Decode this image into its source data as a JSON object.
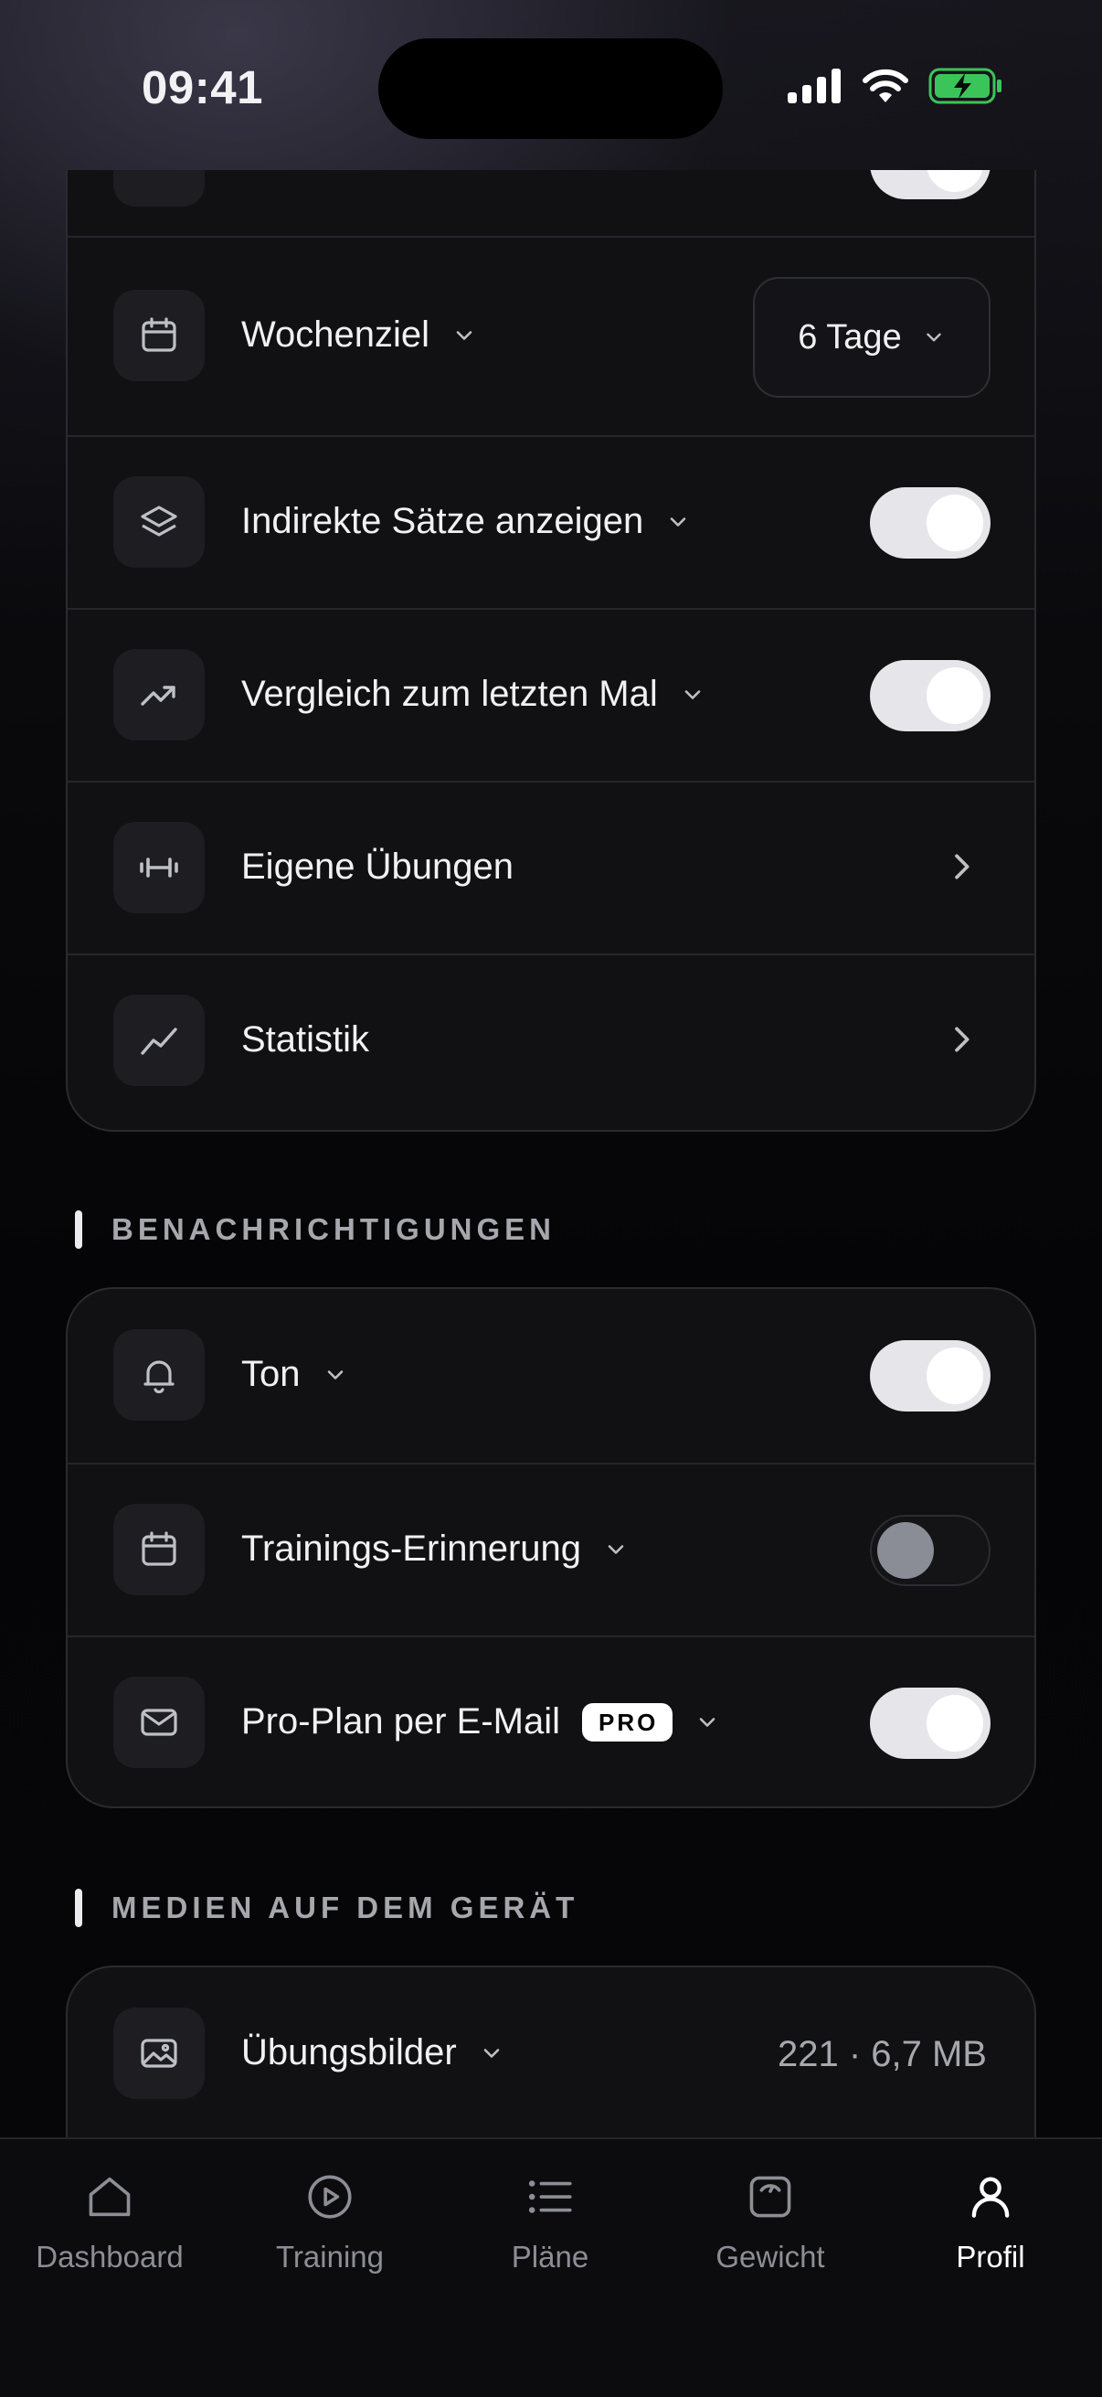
{
  "status_bar": {
    "time": "09:41"
  },
  "settings_card": {
    "rows": [
      {
        "label": "Wochenziel",
        "select_value": "6 Tage"
      },
      {
        "label": "Indirekte Sätze anzeigen",
        "toggle_on": true
      },
      {
        "label": "Vergleich zum letzten Mal",
        "toggle_on": true
      },
      {
        "label": "Eigene Übungen"
      },
      {
        "label": "Statistik"
      }
    ]
  },
  "notifications": {
    "title": "BENACHRICHTIGUNGEN",
    "rows": [
      {
        "label": "Ton",
        "toggle_on": true
      },
      {
        "label": "Trainings-Erinnerung",
        "toggle_on": false
      },
      {
        "label": "Pro-Plan per E-Mail",
        "badge": "PRO",
        "toggle_on": true
      }
    ]
  },
  "media": {
    "title": "MEDIEN AUF DEM GERÄT",
    "rows": [
      {
        "label": "Übungsbilder",
        "value": "221 · 6,7 MB"
      }
    ]
  },
  "tabbar": {
    "tabs": [
      {
        "label": "Dashboard",
        "icon": "home-icon"
      },
      {
        "label": "Training",
        "icon": "play-circle-icon"
      },
      {
        "label": "Pläne",
        "icon": "list-icon"
      },
      {
        "label": "Gewicht",
        "icon": "scale-icon"
      },
      {
        "label": "Profil",
        "icon": "user-icon",
        "active": true
      }
    ]
  },
  "colors": {
    "toggle_on": "#e6e6ea",
    "card_bg": "#111114",
    "accent": "#ffffff"
  }
}
